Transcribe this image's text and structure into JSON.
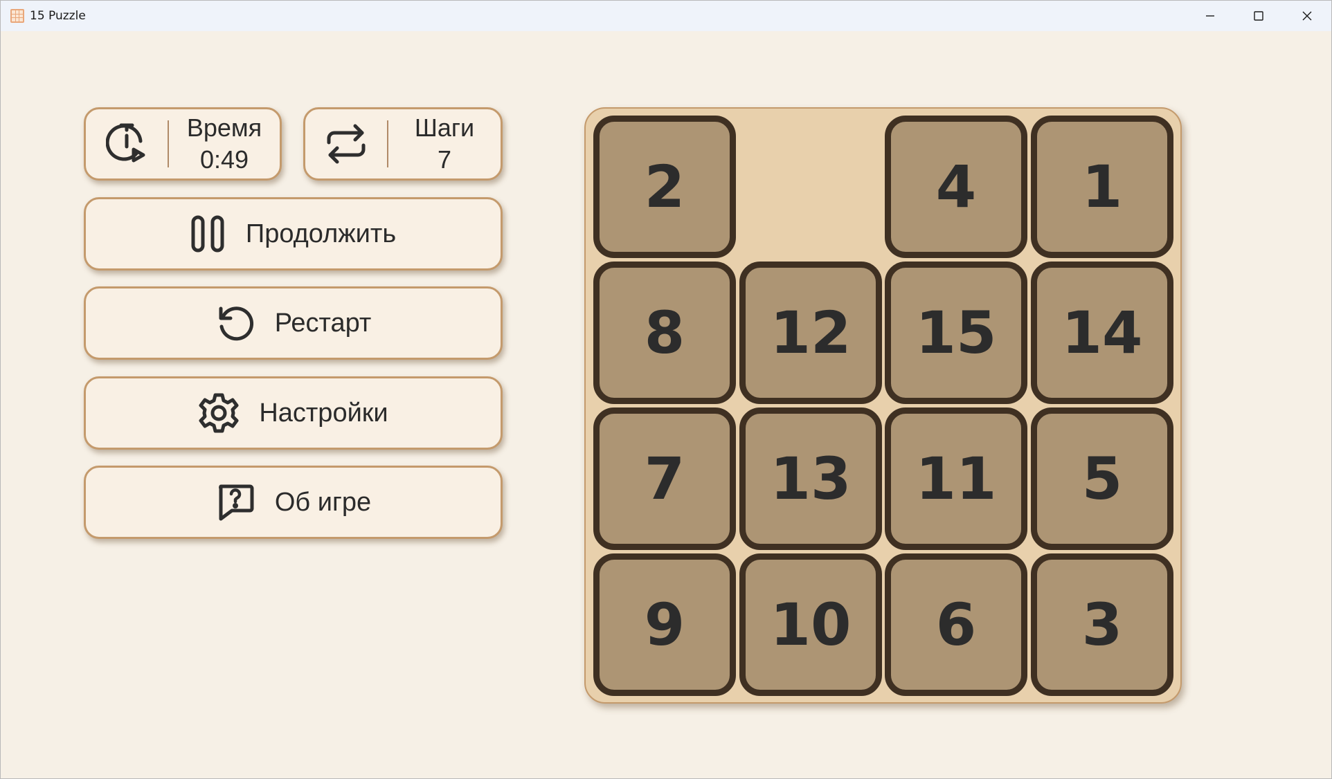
{
  "window": {
    "title": "15 Puzzle",
    "controls": [
      "minimize-icon",
      "maximize-icon",
      "close-icon"
    ]
  },
  "stats": {
    "time_label": "Время",
    "time_value": "0:49",
    "steps_label": "Шаги",
    "steps_value": "7"
  },
  "buttons": {
    "continue": "Продолжить",
    "restart": "Рестарт",
    "settings": "Настройки",
    "about": "Об игре"
  },
  "board": {
    "rows": [
      [
        "2",
        "",
        "4",
        "1"
      ],
      [
        "8",
        "12",
        "15",
        "14"
      ],
      [
        "7",
        "13",
        "11",
        "5"
      ],
      [
        "9",
        "10",
        "6",
        "3"
      ]
    ]
  },
  "colors": {
    "background": "#f6f0e6",
    "panel": "#f9f0e4",
    "panel_border": "#c49a6c",
    "board": "#e8d0ac",
    "tile": "#ad9574",
    "tile_border": "#3f3022",
    "tile_text": "#2c2c2c"
  }
}
